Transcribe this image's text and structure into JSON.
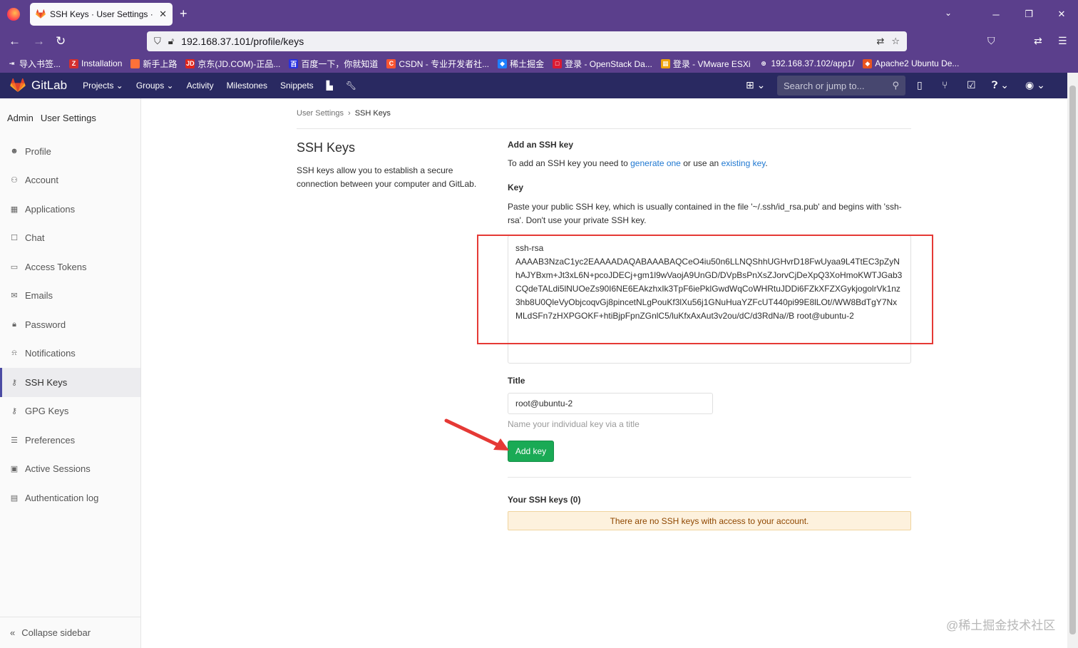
{
  "browser": {
    "tab_title": "SSH Keys · User Settings · GitLab",
    "url": "192.168.37.101/profile/keys",
    "bookmarks": [
      {
        "label": "导入书签...",
        "color": "#5b3f8c",
        "glyph": "⇥"
      },
      {
        "label": "Installation",
        "color": "#d32f2f",
        "glyph": "Z"
      },
      {
        "label": "新手上路",
        "color": "#ff7139",
        "glyph": ""
      },
      {
        "label": "京东(JD.COM)-正品...",
        "color": "#e1251b",
        "glyph": "JD"
      },
      {
        "label": "百度一下，你就知道",
        "color": "#2932e1",
        "glyph": "百"
      },
      {
        "label": "CSDN - 专业开发者社...",
        "color": "#fc5531",
        "glyph": "C"
      },
      {
        "label": "稀土掘金",
        "color": "#1e80ff",
        "glyph": "◆"
      },
      {
        "label": "登录 - OpenStack Da...",
        "color": "#da1a32",
        "glyph": "□"
      },
      {
        "label": "登录 - VMware ESXi",
        "color": "#f0a30a",
        "glyph": "▦"
      },
      {
        "label": "192.168.37.102/app1/",
        "color": "#5b3f8c",
        "glyph": "⊕"
      },
      {
        "label": "Apache2 Ubuntu De...",
        "color": "#e95420",
        "glyph": "◆"
      }
    ]
  },
  "gitlab": {
    "brand": "GitLab",
    "menu": [
      "Projects ⌄",
      "Groups ⌄",
      "Activity",
      "Milestones",
      "Snippets"
    ],
    "search_placeholder": "Search or jump to..."
  },
  "sidebar": {
    "context_left": "Admin",
    "context_title": "User Settings",
    "items": [
      {
        "label": "Profile",
        "icon": "☻"
      },
      {
        "label": "Account",
        "icon": "⚇"
      },
      {
        "label": "Applications",
        "icon": "▦"
      },
      {
        "label": "Chat",
        "icon": "☐"
      },
      {
        "label": "Access Tokens",
        "icon": "▭"
      },
      {
        "label": "Emails",
        "icon": "✉"
      },
      {
        "label": "Password",
        "icon": "🔒︎"
      },
      {
        "label": "Notifications",
        "icon": "⍾"
      },
      {
        "label": "SSH Keys",
        "icon": "⚷"
      },
      {
        "label": "GPG Keys",
        "icon": "⚷"
      },
      {
        "label": "Preferences",
        "icon": "☰"
      },
      {
        "label": "Active Sessions",
        "icon": "▣"
      },
      {
        "label": "Authentication log",
        "icon": "▤"
      }
    ],
    "active_index": 8,
    "collapse_label": "Collapse sidebar"
  },
  "breadcrumb": {
    "parent": "User Settings",
    "current": "SSH Keys"
  },
  "intro": {
    "title": "SSH Keys",
    "description": "SSH keys allow you to establish a secure connection between your computer and GitLab."
  },
  "form": {
    "heading": "Add an SSH key",
    "add_text_1": "To add an SSH key you need to ",
    "link_generate": "generate one",
    "add_text_2": " or use an ",
    "link_existing": "existing key",
    "add_text_3": ".",
    "key_label": "Key",
    "key_help": "Paste your public SSH key, which is usually contained in the file '~/.ssh/id_rsa.pub' and begins with 'ssh-rsa'. Don't use your private SSH key.",
    "key_value": "ssh-rsa\nAAAAB3NzaC1yc2EAAAADAQABAAABAQCeO4iu50n6LLNQShhUGHvrD18FwUyaa9L4TtEC3pZyNhAJYBxm+Jt3xL6N+pcoJDECj+gm1l9wVaojA9UnGD/DVpBsPnXsZJorvCjDeXpQ3XoHmoKWTJGab3CQdeTALdi5lNUOeZs90I6NE6EAkzhxIk3TpF6iePklGwdWqCoWHRtuJDDi6FZkXFZXGykjogolrVk1nz3hb8U0QleVyObjcoqvGj8pincetNLgPouKf3lXu56j1GNuHuaYZFcUT440pi99E8lLOt//WW8BdTgY7NxMLdSFn7zHXPGOKF+htiBjpFpnZGnlC5/luKfxAxAut3v2ou/dC/d3RdNa//B root@ubuntu-2",
    "title_label": "Title",
    "title_value": "root@ubuntu-2",
    "title_hint": "Name your individual key via a title",
    "submit_label": "Add key",
    "your_keys_label": "Your SSH keys (0)",
    "empty_message": "There are no SSH keys with access to your account."
  },
  "watermark": "@稀土掘金技术社区",
  "colors": {
    "header": "#292961",
    "browser": "#5b3f8c",
    "primary": "#1aaa55",
    "link": "#1f78d1",
    "annotation": "#e53935"
  }
}
